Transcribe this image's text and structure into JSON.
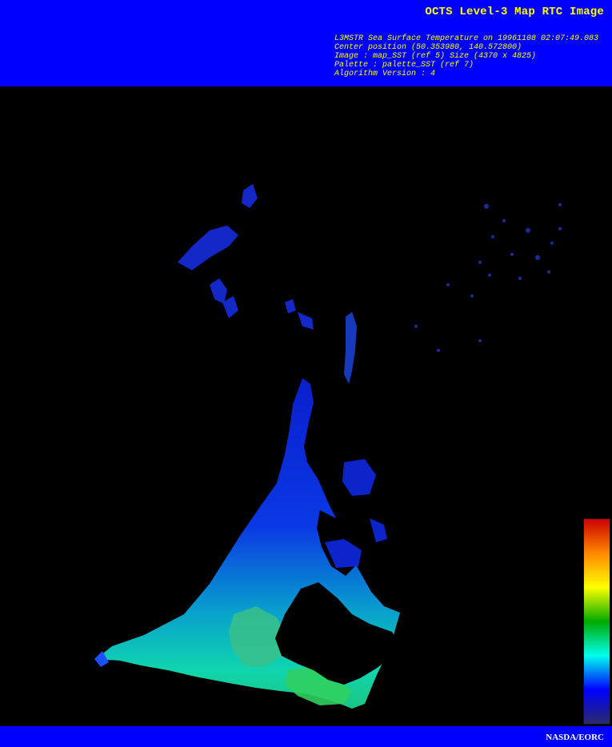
{
  "header": {
    "title": "OCTS Level-3 Map RTC Image",
    "meta_lines": [
      "L3MSTR Sea Surface Temperature on 19961108 02:07:49.083",
      "Center position (50.353980, 140.572800)",
      "Image : map_SST (ref 5) Size (4370 x 4825)",
      "Palette : palette_SST (ref 7)",
      "Algorithm Version : 4"
    ]
  },
  "footer": {
    "credit": "NASDA/EORC"
  },
  "colors": {
    "banner": "#0000ff",
    "title_text": "#ffff00",
    "credit_text": "#ffffff",
    "background": "#000000",
    "palette_stops": [
      "#cc0000",
      "#ff8800",
      "#ffff00",
      "#00aa00",
      "#00ffee",
      "#0000ff",
      "#2a2a6a"
    ]
  }
}
